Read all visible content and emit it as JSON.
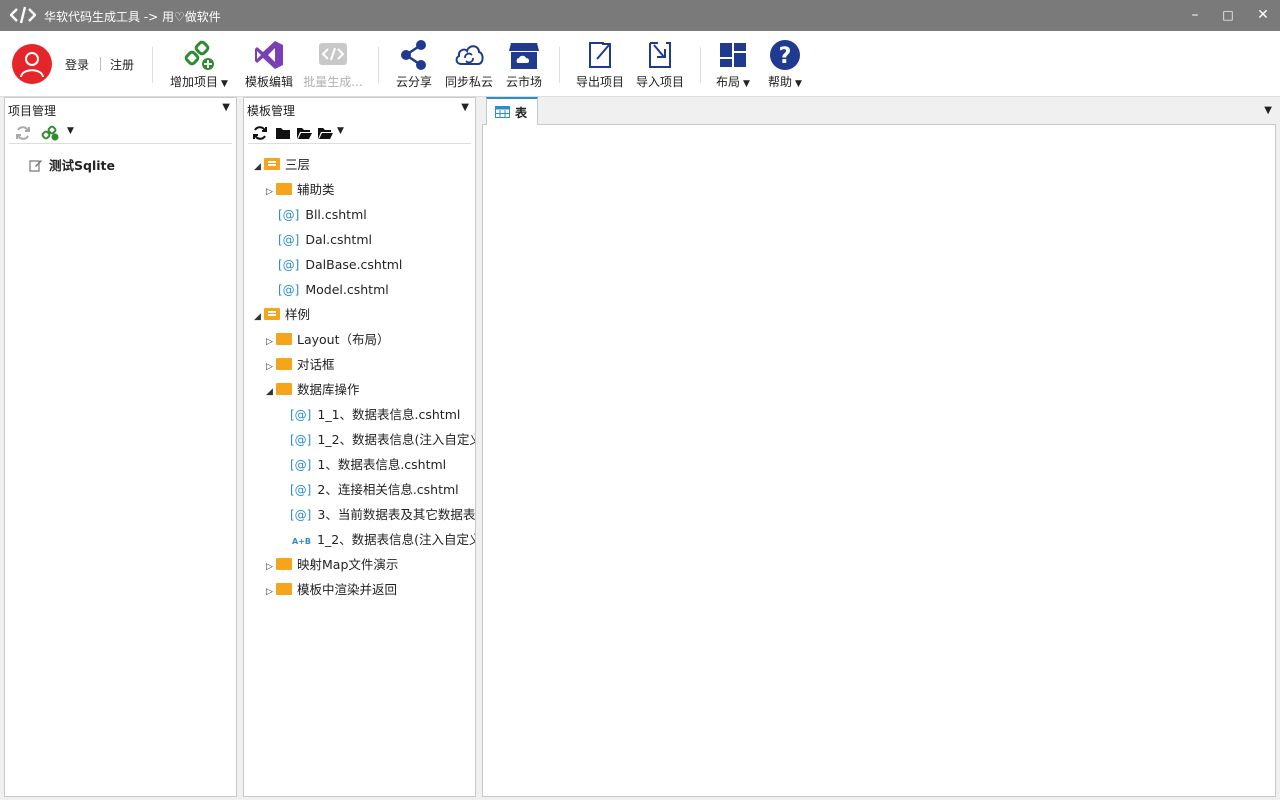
{
  "window": {
    "title": "华软代码生成工具 -> 用♡做软件",
    "minimize_glyph": "–",
    "maximize_glyph": "□",
    "close_glyph": "✕"
  },
  "toolbar": {
    "login": "登录",
    "register": "注册",
    "add_project": "增加项目",
    "template_edit": "模板编辑",
    "batch_generate": "批量生成...",
    "cloud_share": "云分享",
    "sync_cloud": "同步私云",
    "cloud_market": "云市场",
    "export_project": "导出项目",
    "import_project": "导入项目",
    "layout": "布局",
    "help": "帮助"
  },
  "project_panel": {
    "title": "项目管理",
    "items": [
      "测试Sqlite"
    ]
  },
  "template_panel": {
    "title": "模板管理",
    "tree": {
      "n0": "三层",
      "n1": "辅助类",
      "n2": "Bll.cshtml",
      "n3": "Dal.cshtml",
      "n4": "DalBase.cshtml",
      "n5": "Model.cshtml",
      "n6": "样例",
      "n7": "Layout（布局）",
      "n8": "对话框",
      "n9": "数据库操作",
      "n10": "1_1、数据表信息.cshtml",
      "n11": "1_2、数据表信息(注入自定义",
      "n12": "1、数据表信息.cshtml",
      "n13": "2、连接相关信息.cshtml",
      "n14": "3、当前数据表及其它数据表",
      "n15": "1_2、数据表信息(注入自定义",
      "n16": "映射Map文件演示",
      "n17": "模板中渲染并返回"
    },
    "file_prefix": "[@]",
    "ab_prefix": "A+B"
  },
  "editor": {
    "tab_label": "表"
  },
  "colors": {
    "titlebar": "#7a7a7a",
    "accent": "#2b8ccf",
    "folder": "#f4a51c",
    "green": "#2e8b2e",
    "purple": "#7b3fb5",
    "navy": "#1f3a8f",
    "avatar": "#e4262a"
  }
}
